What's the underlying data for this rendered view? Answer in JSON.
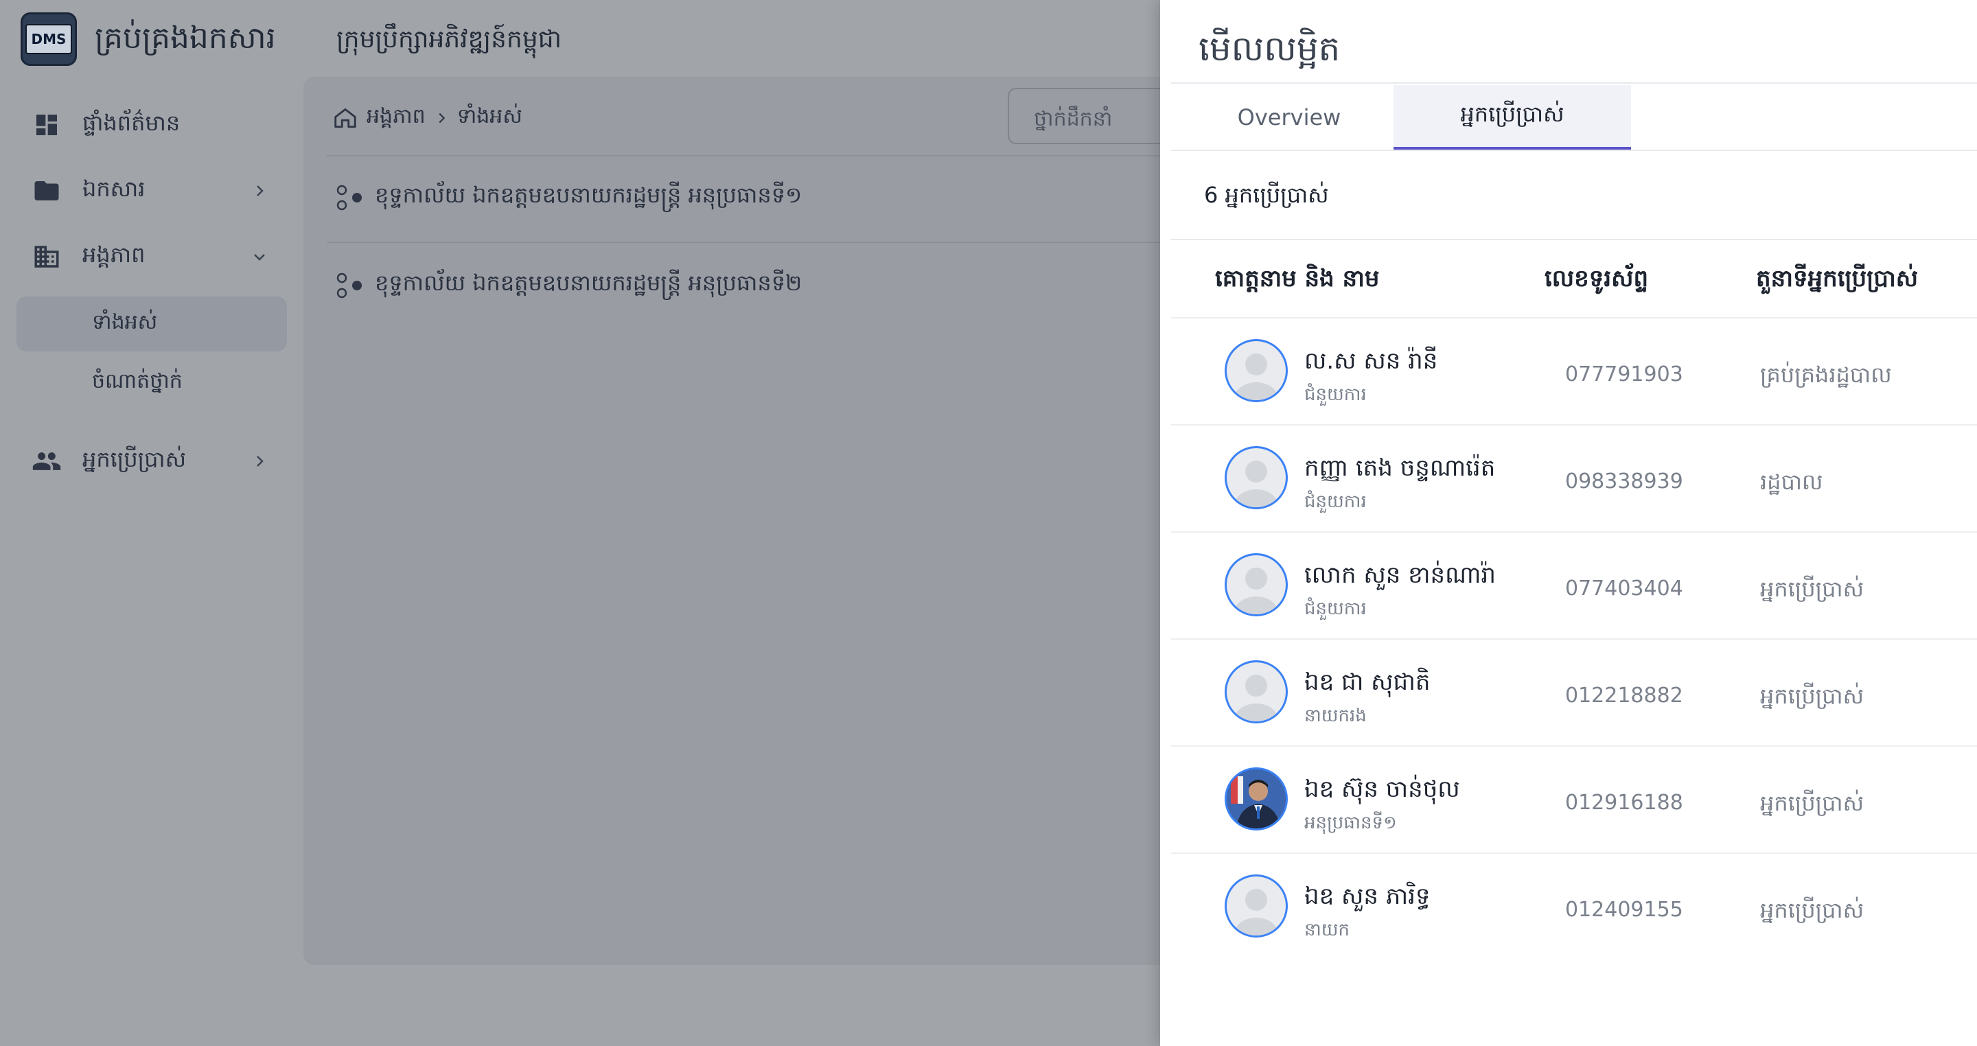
{
  "app": {
    "logo_text": "DMS",
    "title": "គ្រប់គ្រងឯកសារ",
    "org_name": "ក្រុមប្រឹក្សាអភិវឌ្ឍន៍កម្ពុជា"
  },
  "sidebar": {
    "items": [
      {
        "label": "ផ្ទាំងព័ត៌មាន",
        "icon": "dashboard-icon"
      },
      {
        "label": "ឯកសារ",
        "icon": "folder-icon"
      },
      {
        "label": "អង្គភាព",
        "icon": "building-icon"
      },
      {
        "label": "អ្នកប្រើប្រាស់",
        "icon": "people-icon"
      }
    ],
    "sub_items": [
      "ទាំងអស់",
      "ចំណាត់ថ្នាក់"
    ]
  },
  "main": {
    "breadcrumb": [
      "អង្គភាព",
      "ទាំងអស់"
    ],
    "filter_placeholder": "ថ្នាក់ដឹកនាំ",
    "units": [
      "ខុទ្ទកាល័យ ឯកឧត្តមឧបនាយករដ្ឋមន្ត្រី អនុប្រធានទី១",
      "ខុទ្ទកាល័យ ឯកឧត្តមឧបនាយករដ្ឋមន្ត្រី អនុប្រធានទី២"
    ]
  },
  "drawer": {
    "title": "មើលលម្អិត",
    "tabs": [
      "Overview",
      "អ្នកប្រើប្រាស់"
    ],
    "active_tab": "អ្នកប្រើប្រាស់",
    "user_count": "6 អ្នកប្រើប្រាស់",
    "table": {
      "headers": [
        "គោត្តនាម និង នាម",
        "លេខទូរស័ព្ទ",
        "តួនាទីអ្នកប្រើប្រាស់"
      ],
      "rows": [
        {
          "name": "ល.ស សន រ៉ានី",
          "role": "ជំនួយការ",
          "phone": "077791903",
          "user_type": "គ្រប់គ្រងរដ្ឋបាល",
          "avatar": "default"
        },
        {
          "name": "កញ្ញា តេង ចន្ទណារ៉េត",
          "role": "ជំនួយការ",
          "phone": "098338939",
          "user_type": "រដ្ឋបាល",
          "avatar": "default"
        },
        {
          "name": "លោក សួន ខាន់ណារ៉ា",
          "role": "ជំនួយការ",
          "phone": "077403404",
          "user_type": "អ្នកប្រើប្រាស់",
          "avatar": "default"
        },
        {
          "name": "ឯឧ ជា សុជាតិ",
          "role": "នាយករង",
          "phone": "012218882",
          "user_type": "អ្នកប្រើប្រាស់",
          "avatar": "default"
        },
        {
          "name": "ឯឧ ស៊ុន ចាន់ថុល",
          "role": "អនុប្រធានទី១",
          "phone": "012916188",
          "user_type": "អ្នកប្រើប្រាស់",
          "avatar": "photo"
        },
        {
          "name": "ឯឧ សួន ភារិទ្ធ",
          "role": "នាយក",
          "phone": "012409155",
          "user_type": "អ្នកប្រើប្រាស់",
          "avatar": "default"
        }
      ]
    }
  },
  "colors": {
    "overlay": "#a1a4a9",
    "accent": "#5b52c9",
    "avatar_ring": "#3b82f6"
  }
}
